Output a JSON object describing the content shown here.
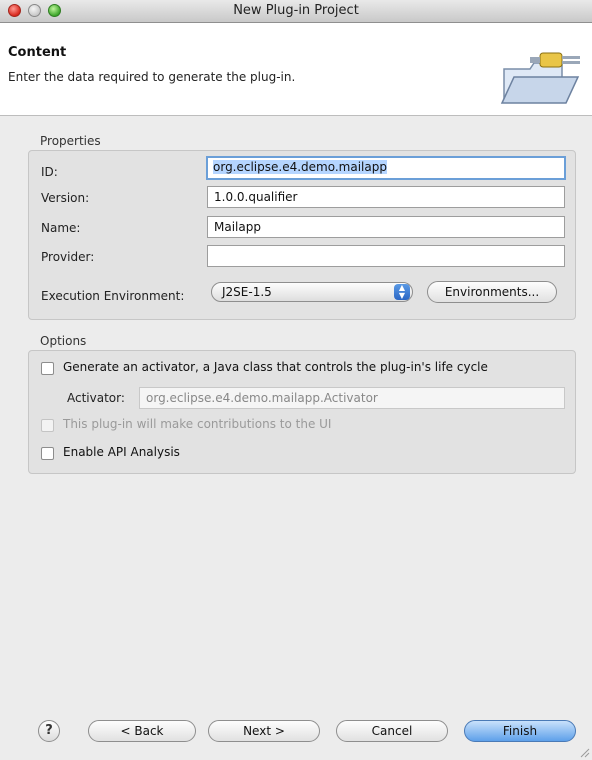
{
  "window": {
    "title": "New Plug-in Project"
  },
  "header": {
    "title": "Content",
    "subtitle": "Enter the data required to generate the plug-in."
  },
  "properties": {
    "label": "Properties",
    "id_label": "ID:",
    "id_value": "org.eclipse.e4.demo.mailapp",
    "version_label": "Version:",
    "version_value": "1.0.0.qualifier",
    "name_label": "Name:",
    "name_value": "Mailapp",
    "provider_label": "Provider:",
    "provider_value": "",
    "exec_env_label": "Execution Environment:",
    "exec_env_value": "J2SE-1.5",
    "environments_button": "Environments..."
  },
  "options": {
    "label": "Options",
    "generate_activator_label": "Generate an activator, a Java class that controls the plug-in's life cycle",
    "generate_activator_checked": false,
    "activator_label": "Activator:",
    "activator_value": "org.eclipse.e4.demo.mailapp.Activator",
    "ui_contrib_label": "This plug-in will make contributions to the UI",
    "ui_contrib_checked": false,
    "ui_contrib_enabled": false,
    "api_analysis_label": "Enable API Analysis",
    "api_analysis_checked": false
  },
  "buttons": {
    "help": "?",
    "back": "< Back",
    "next": "Next >",
    "cancel": "Cancel",
    "finish": "Finish"
  },
  "icons": {
    "close": "close-traffic-light",
    "minimize": "minimize-traffic-light",
    "zoom": "zoom-traffic-light",
    "banner": "folder-plug-icon",
    "dropdown": "updown-arrows-icon"
  },
  "colors": {
    "selection": "#b5d5ff",
    "focus": "#6b9fd8",
    "default_button": "#5ea0ea"
  }
}
